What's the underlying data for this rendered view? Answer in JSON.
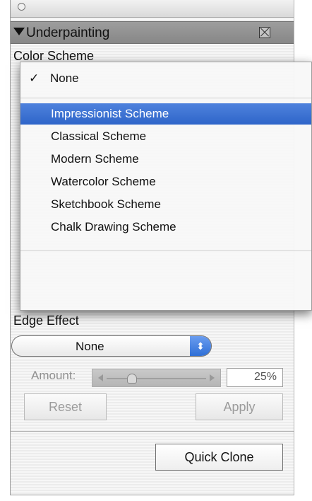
{
  "panel": {
    "section_title": "Underpainting",
    "color_scheme_label": "Color Scheme",
    "edge_effect_label": "Edge Effect"
  },
  "color_scheme_menu": {
    "checked_item": "None",
    "checkmark": "✓",
    "items": [
      "Impressionist Scheme",
      "Classical Scheme",
      "Modern Scheme",
      "Watercolor Scheme",
      "Sketchbook Scheme",
      "Chalk Drawing Scheme"
    ],
    "selected_index": 0
  },
  "edge_effect": {
    "selected_value": "None",
    "stepper_glyph": "⬍"
  },
  "amount": {
    "label": "Amount:",
    "value_text": "25%",
    "value": 25
  },
  "buttons": {
    "reset": "Reset",
    "apply": "Apply",
    "quick_clone": "Quick Clone"
  },
  "colors": {
    "menu_highlight": "#3a6fd3",
    "stepper_blue": "#2f6fd6",
    "header_gray": "#8f8f8f"
  },
  "icons": {
    "collapse": "disclosure-triangle-icon",
    "close": "close-box-icon",
    "window": "window-circle-icon"
  }
}
